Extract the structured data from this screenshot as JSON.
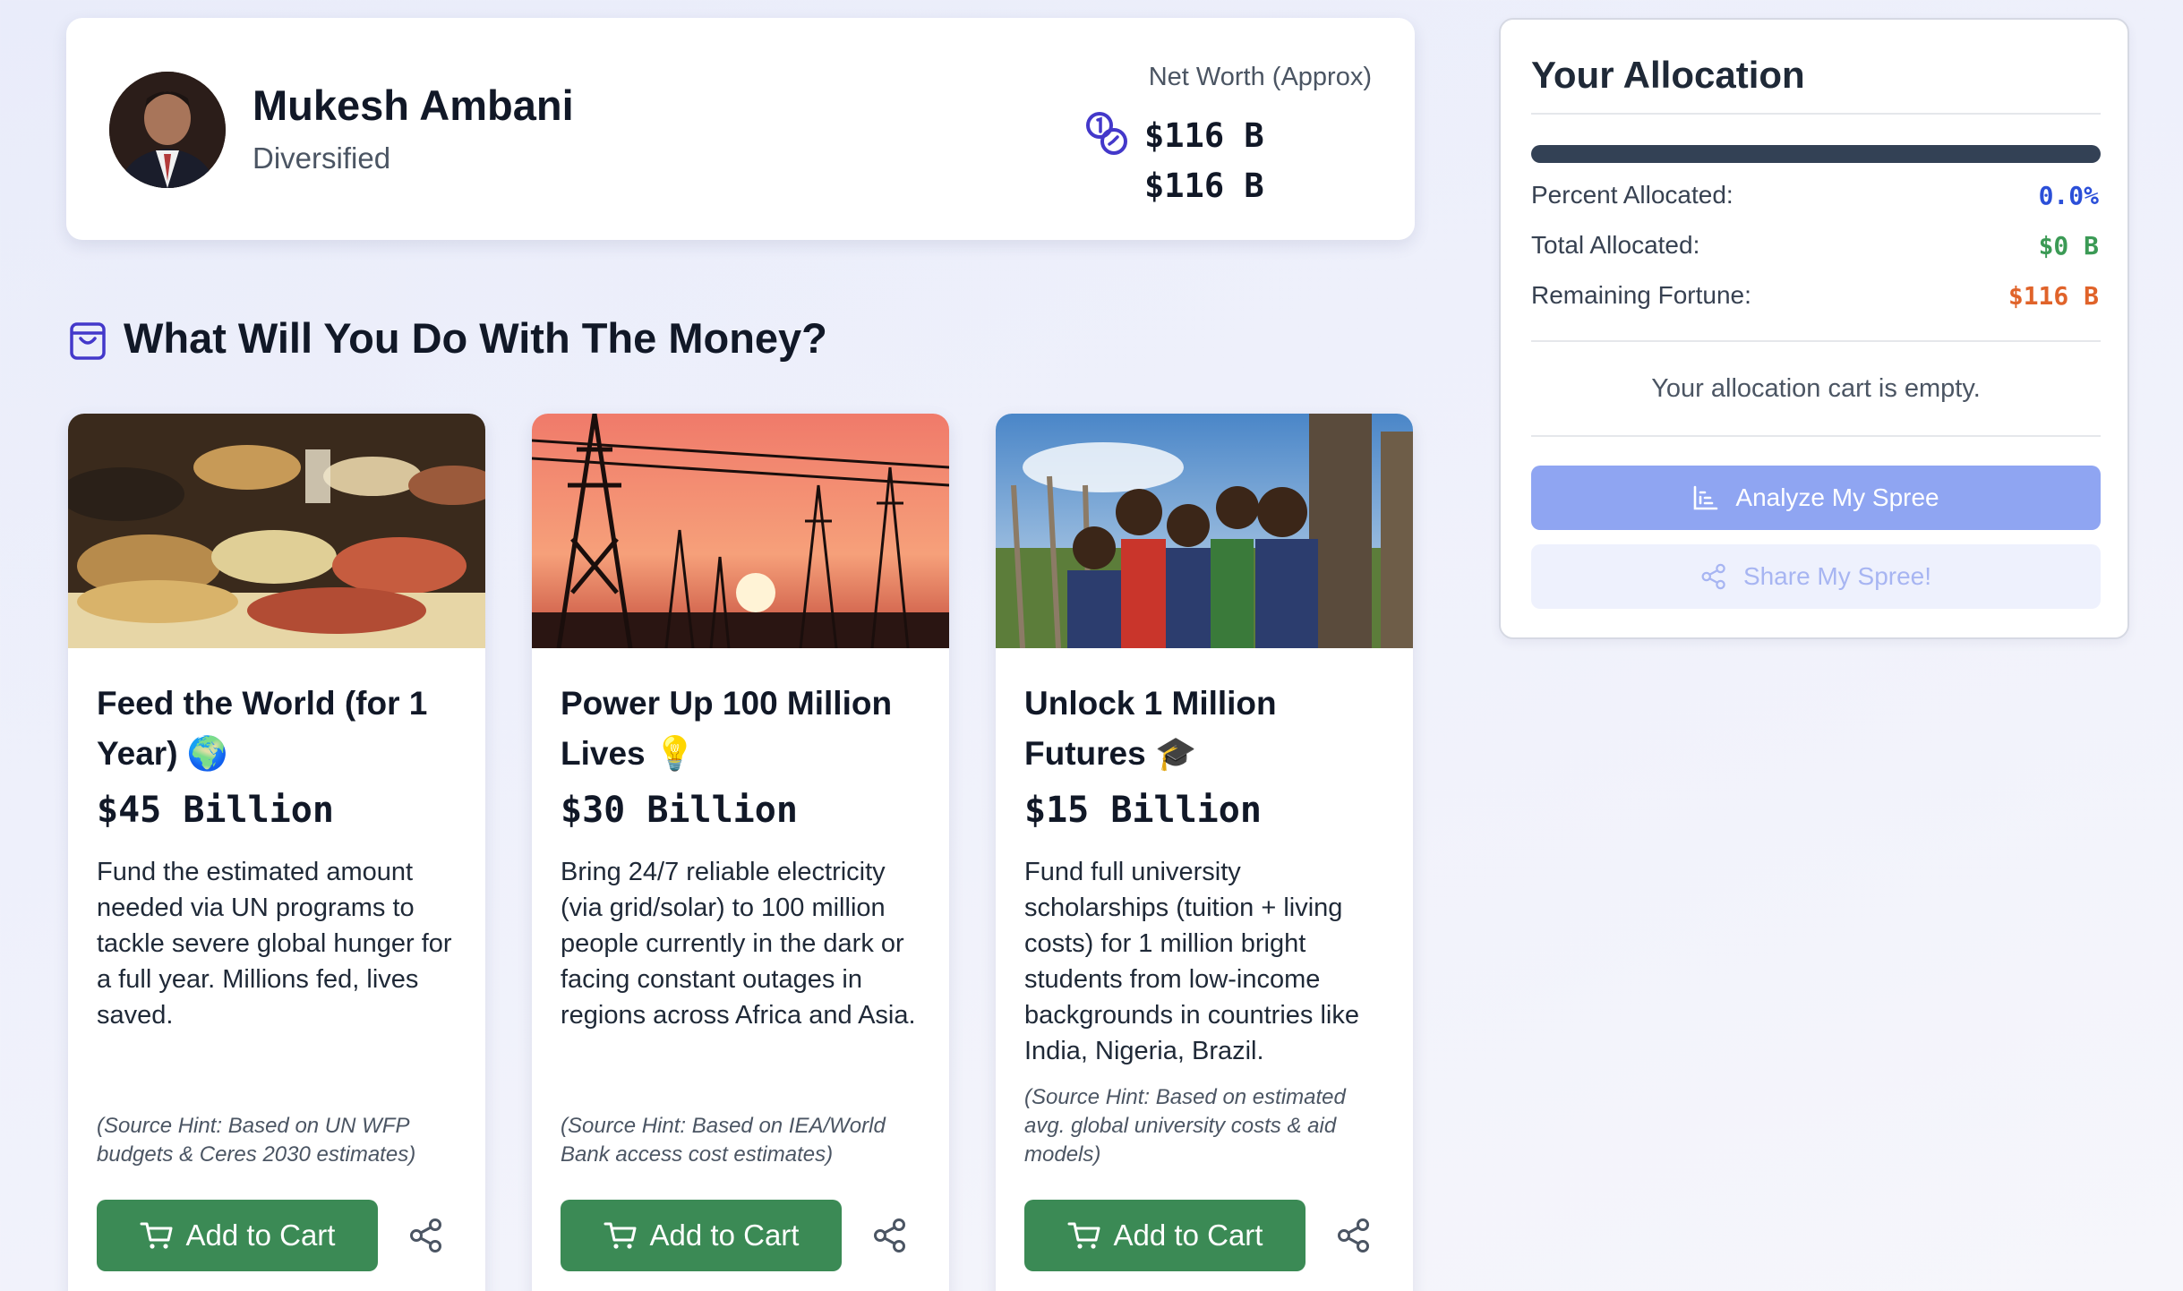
{
  "profile": {
    "name": "Mukesh Ambani",
    "sector": "Diversified",
    "net_worth_label": "Net Worth (Approx)",
    "net_worth_value_1": "$116 B",
    "net_worth_value_2": "$116 B"
  },
  "section": {
    "title": "What Will You Do With The Money?",
    "icon": "shopping-bag-icon"
  },
  "cards": [
    {
      "title": "Feed the World (for 1 Year) 🌍",
      "price": "$45 Billion",
      "description": "Fund the estimated amount needed via UN programs to tackle severe global hunger for a full year. Millions fed, lives saved.",
      "hint": "(Source Hint: Based on UN WFP budgets & Ceres 2030 estimates)",
      "button": "Add to Cart"
    },
    {
      "title": "Power Up 100 Million Lives 💡",
      "price": "$30 Billion",
      "description": "Bring 24/7 reliable electricity (via grid/solar) to 100 million people currently in the dark or facing constant outages in regions across Africa and Asia.",
      "hint": "(Source Hint: Based on IEA/World Bank access cost estimates)",
      "button": "Add to Cart"
    },
    {
      "title": "Unlock 1 Million Futures 🎓",
      "price": "$15 Billion",
      "description": "Fund full university scholarships (tuition + living costs) for 1 million bright students from low-income backgrounds in countries like India, Nigeria, Brazil.",
      "hint": "(Source Hint: Based on estimated avg. global university costs & aid models)",
      "button": "Add to Cart"
    }
  ],
  "allocation": {
    "title": "Your Allocation",
    "progress_percent": 0,
    "percent_label": "Percent Allocated:",
    "percent_value": "0.0%",
    "total_label": "Total Allocated:",
    "total_value": "$0 B",
    "remaining_label": "Remaining Fortune:",
    "remaining_value": "$116 B",
    "empty_message": "Your allocation cart is empty.",
    "analyze_button": "Analyze My Spree",
    "share_button": "Share My Spree!"
  },
  "colors": {
    "accent_blue": "#2b4fd8",
    "positive_green": "#3b9a55",
    "remaining_orange": "#e0632a",
    "button_green": "#3b8a55"
  }
}
